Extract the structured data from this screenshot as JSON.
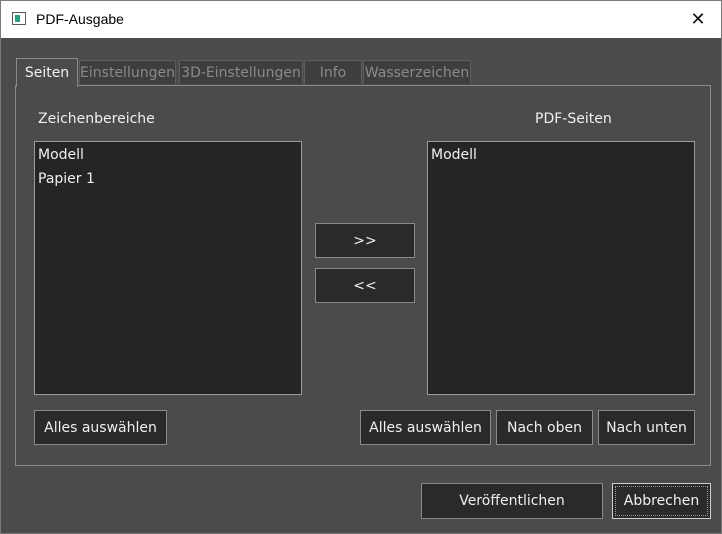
{
  "window": {
    "title": "PDF-Ausgabe",
    "close_glyph": "✕"
  },
  "tabs": [
    {
      "label": "Seiten",
      "active": true
    },
    {
      "label": "Einstellungen",
      "active": false
    },
    {
      "label": "3D-Einstellungen",
      "active": false
    },
    {
      "label": "Info",
      "active": false
    },
    {
      "label": "Wasserzeichen",
      "active": false
    }
  ],
  "left": {
    "heading": "Zeichenbereiche",
    "items": [
      "Modell",
      "Papier 1"
    ],
    "select_all_label": "Alles auswählen"
  },
  "middle": {
    "add_label": ">>",
    "remove_label": "<<"
  },
  "right": {
    "heading": "PDF-Seiten",
    "items": [
      "Modell"
    ],
    "select_all_label": "Alles auswählen",
    "move_up_label": "Nach oben",
    "move_down_label": "Nach unten"
  },
  "footer": {
    "publish_label": "Veröffentlichen",
    "cancel_label": "Abbrechen"
  }
}
